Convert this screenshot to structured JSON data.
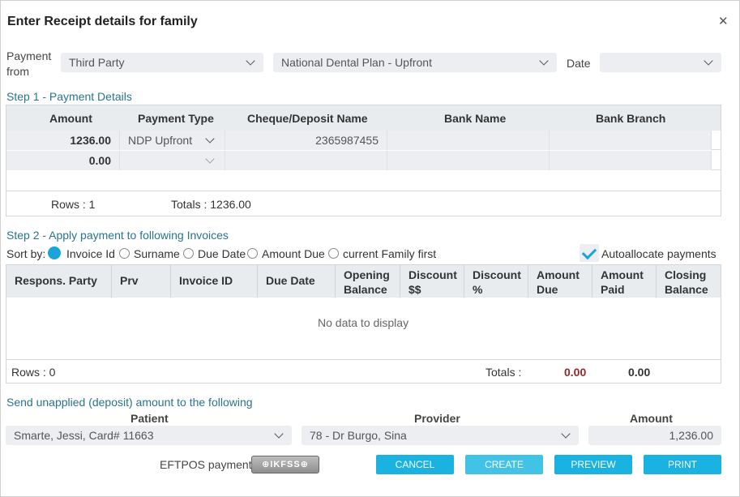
{
  "dialog": {
    "title": "Enter Receipt details for family"
  },
  "payment": {
    "label_line1": "Payment",
    "label_line2": "from",
    "from_value": "Third Party",
    "plan_value": "National Dental Plan - Upfront",
    "date_label": "Date",
    "date_value": ""
  },
  "step1": {
    "title": "Step 1 - Payment Details",
    "headers": {
      "amount": "Amount",
      "type": "Payment Type",
      "cheque": "Cheque/Deposit Name",
      "bank": "Bank Name",
      "branch": "Bank Branch"
    },
    "rows": [
      {
        "amount": "1236.00",
        "type": "NDP Upfront",
        "cheque": "2365987455",
        "bank": "",
        "branch": ""
      },
      {
        "amount": "0.00",
        "type": "",
        "cheque": "",
        "bank": "",
        "branch": ""
      }
    ],
    "rows_label": "Rows : 1",
    "totals_label": "Totals : 1236.00"
  },
  "step2": {
    "title": "Step 2 - Apply payment to following Invoices",
    "sort_label": "Sort by:",
    "sort_options": [
      "Invoice Id",
      "Surname",
      "Due Date",
      "Amount Due",
      "current Family first"
    ],
    "autoallocate_label": "Autoallocate payments",
    "headers": {
      "party": "Respons. Party",
      "prv": "Prv",
      "invoice": "Invoice ID",
      "due": "Due Date",
      "opening_1": "Opening",
      "opening_2": "Balance",
      "discount_d_1": "Discount",
      "discount_d_2": "$$",
      "discount_p_1": "Discount",
      "discount_p_2": "%",
      "amount_due_1": "Amount",
      "amount_due_2": "Due",
      "amount_paid_1": "Amount",
      "amount_paid_2": "Paid",
      "closing_1": "Closing",
      "closing_2": "Balance"
    },
    "no_data": "No data to display",
    "rows_label": "Rows : 0",
    "totals_label": "Totals :",
    "total_red": "0.00",
    "total_black": "0.00"
  },
  "unapplied": {
    "title": "Send unapplied (deposit) amount to the following",
    "patient_header": "Patient",
    "provider_header": "Provider",
    "amount_header": "Amount",
    "patient_value": "Smarte, Jessi, Card# 11663",
    "provider_value": "78 - Dr Burgo, Sina",
    "amount_value": "1,236.00"
  },
  "footer": {
    "eftpos_label": "EFTPOS payment",
    "eftpos_icon_text": "⊕IKFSS⊕",
    "cancel": "CANCEL",
    "create": "CREATE",
    "preview": "PREVIEW",
    "print": "PRINT"
  },
  "colors": {
    "accent": "#1ab2e0",
    "section": "#2a7490",
    "total_red": "#8b2c2c"
  }
}
